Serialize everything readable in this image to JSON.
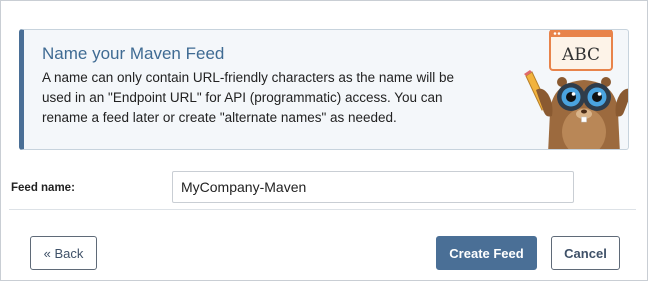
{
  "info": {
    "title": "Name your Maven Feed",
    "text": "A name can only contain URL-friendly characters as the name will be used in an \"Endpoint URL\" for API (programmatic) access. You can rename a feed later or create \"alternate names\" as needed.",
    "mascot_sign": "ABC"
  },
  "form": {
    "feed_name_label": "Feed name:",
    "feed_name_value": "MyCompany-Maven"
  },
  "buttons": {
    "back": "« Back",
    "create": "Create Feed",
    "cancel": "Cancel"
  },
  "colors": {
    "accent": "#4a6f96",
    "title": "#3f6b93",
    "panel_bg": "#f4f7fa",
    "mascot_sign": "#e8834a"
  }
}
